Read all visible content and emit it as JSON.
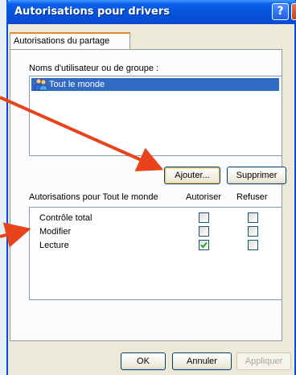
{
  "window": {
    "title": "Autorisations pour drivers",
    "help_glyph": "?",
    "close_glyph": "✕"
  },
  "tabs": [
    {
      "label": "Autorisations du partage",
      "active": true
    }
  ],
  "users": {
    "label": "Noms d'utilisateur ou de groupe :",
    "items": [
      {
        "label": "Tout le monde",
        "icon": "users-group-icon",
        "selected": true
      }
    ]
  },
  "buttons": {
    "add_label": "Ajouter...",
    "remove_label": "Supprimer",
    "ok_label": "OK",
    "cancel_label": "Annuler",
    "apply_label": "Appliquer"
  },
  "permissions": {
    "header": "Autorisations pour Tout le monde",
    "allow_header": "Autoriser",
    "deny_header": "Refuser",
    "rows": [
      {
        "name": "Contrôle total",
        "allow": false,
        "deny": false
      },
      {
        "name": "Modifier",
        "allow": false,
        "deny": false
      },
      {
        "name": "Lecture",
        "allow": true,
        "deny": false
      }
    ]
  },
  "colors": {
    "annotation_arrow": "#e8431a",
    "selection": "#316ac5",
    "titlebar": "#0a49d9"
  }
}
